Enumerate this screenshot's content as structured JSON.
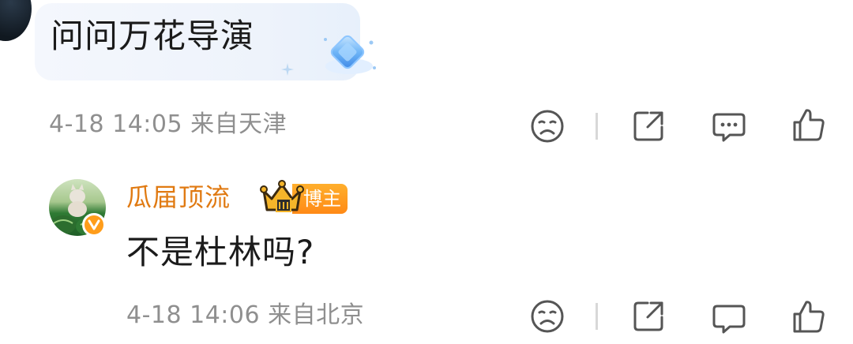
{
  "comments": [
    {
      "text": "问问万花导演",
      "time": "4-18 14:05",
      "location": "来自天津"
    },
    {
      "username": "瓜届顶流",
      "badge_label": "博主",
      "text": "不是杜林吗?",
      "time": "4-18 14:06",
      "location": "来自北京"
    }
  ],
  "actions": [
    "dislike-icon",
    "share-icon",
    "comment-icon",
    "like-icon"
  ],
  "colors": {
    "username": "#e07a12",
    "badge": "#ff8a16",
    "meta": "#8f8f8f",
    "icon": "#555555"
  }
}
